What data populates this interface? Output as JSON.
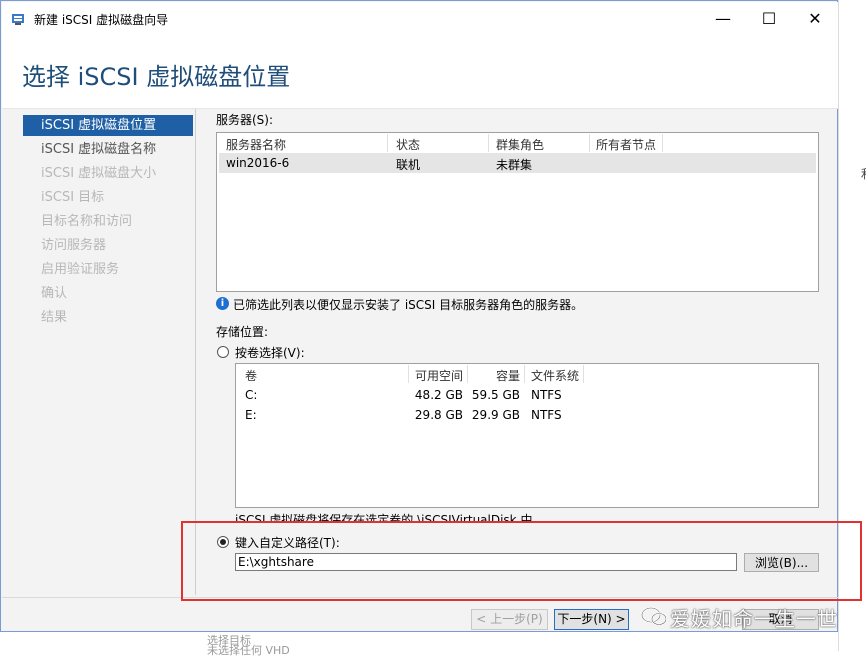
{
  "window": {
    "title": "新建 iSCSI 虚拟磁盘向导",
    "minimize_glyph": "—",
    "maximize_glyph": "☐",
    "close_glyph": "✕"
  },
  "header": {
    "title": "选择 iSCSI 虚拟磁盘位置"
  },
  "nav": [
    {
      "label": "iSCSI 虚拟磁盘位置",
      "state": "active"
    },
    {
      "label": "iSCSI 虚拟磁盘名称",
      "state": "done"
    },
    {
      "label": "iSCSI 虚拟磁盘大小",
      "state": "pending"
    },
    {
      "label": "iSCSI 目标",
      "state": "pending"
    },
    {
      "label": "目标名称和访问",
      "state": "pending"
    },
    {
      "label": "访问服务器",
      "state": "pending"
    },
    {
      "label": "启用验证服务",
      "state": "pending"
    },
    {
      "label": "确认",
      "state": "pending"
    },
    {
      "label": "结果",
      "state": "pending"
    }
  ],
  "servers": {
    "label": "服务器(S):",
    "columns": [
      "服务器名称",
      "状态",
      "群集角色",
      "所有者节点"
    ],
    "rows": [
      [
        "win2016-6",
        "联机",
        "未群集",
        ""
      ]
    ]
  },
  "info_text": "已筛选此列表以便仅显示安装了 iSCSI 目标服务器角色的服务器。",
  "storage": {
    "label": "存储位置:",
    "by_volume_label": "按卷选择(V):",
    "columns": [
      "卷",
      "可用空间",
      "容量",
      "文件系统"
    ],
    "rows": [
      [
        "C:",
        "48.2 GB",
        "59.5 GB",
        "NTFS"
      ],
      [
        "E:",
        "29.8 GB",
        "29.9 GB",
        "NTFS"
      ]
    ],
    "partial_note": "iSCSI 虚拟磁盘将保存在选定卷的 \\iSCSIVirtualDisk 中",
    "custom_path_label": "键入自定义路径(T):",
    "custom_path_value": "E:\\xghtshare",
    "browse_label": "浏览(B)..."
  },
  "footer": {
    "prev_label": "< 上一步(P)",
    "next_label": "下一步(N) >",
    "cancel_label": "取消"
  },
  "background_fragments": {
    "bottom_line1": "选择目标",
    "bottom_line2": "未选择任何 VHD",
    "right_char": "利"
  },
  "watermark": "爱媛如命一生一世",
  "colors": {
    "accent": "#1f5fa5",
    "header_title": "#1e4e79",
    "highlight_box": "#e03232"
  }
}
